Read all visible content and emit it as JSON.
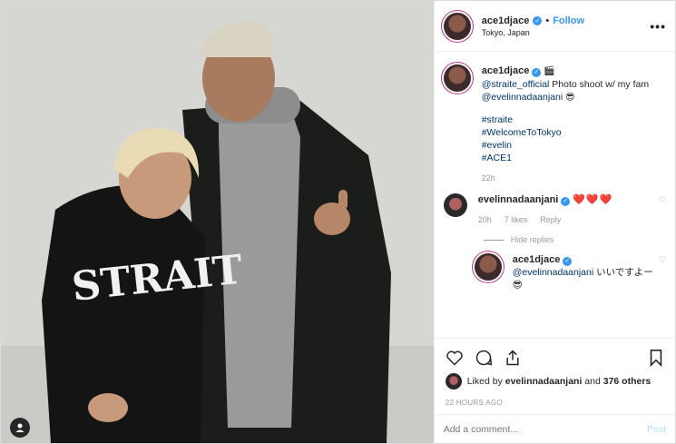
{
  "header": {
    "username": "ace1djace",
    "separator": "•",
    "follow_label": "Follow",
    "location": "Tokyo, Japan",
    "more_label": "•••"
  },
  "caption": {
    "username": "ace1djace",
    "emoji": "🎬",
    "mention1": "@straite_official",
    "text1": " Photo shoot w/ my fam ",
    "mention2": "@evelinnadaanjani",
    "emoji2": "😎",
    "hashtags": [
      "#straite",
      "#WelcomeToTokyo",
      "#evelin",
      "#ACE1"
    ],
    "time": "22h"
  },
  "comment1": {
    "username": "evelinnadaanjani",
    "text": "❤️❤️❤️",
    "time": "20h",
    "likes": "7 likes",
    "reply_label": "Reply",
    "hide_replies": "Hide replies"
  },
  "reply1": {
    "username": "ace1djace",
    "mention": "@evelinnadaanjani",
    "text": " いいですよー😎"
  },
  "likes": {
    "prefix": "Liked by ",
    "user": "evelinnadaanjani",
    "middle": " and ",
    "count": "376 others"
  },
  "timestamp": "22 HOURS AGO",
  "add_comment": {
    "placeholder": "Add a comment...",
    "post_label": "Post"
  },
  "colors": {
    "link": "#003569",
    "accent": "#3897f0",
    "muted": "#999999"
  }
}
